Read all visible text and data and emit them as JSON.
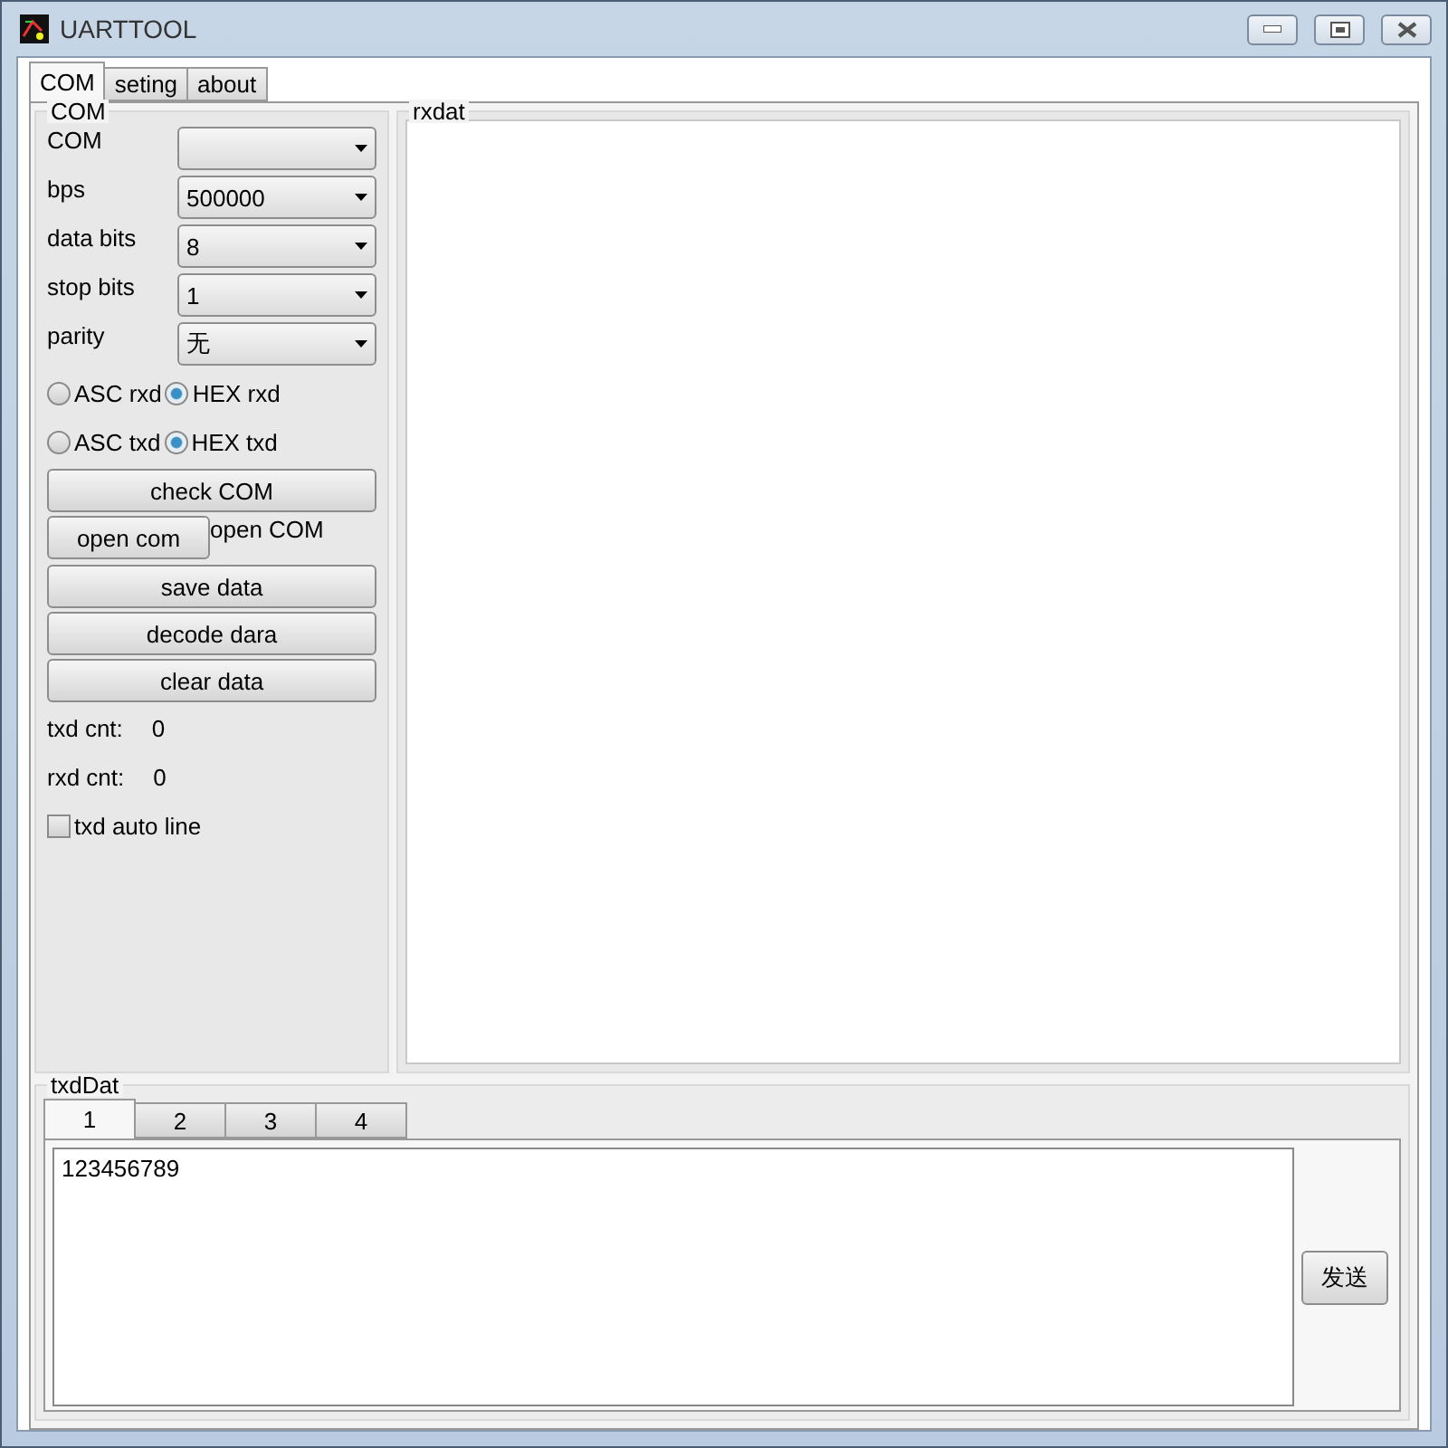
{
  "window": {
    "title": "UARTTOOL"
  },
  "tabs": [
    {
      "label": "COM",
      "selected": true
    },
    {
      "label": "seting",
      "selected": false
    },
    {
      "label": "about",
      "selected": false
    }
  ],
  "com_group": {
    "title": "COM",
    "fields": [
      {
        "label": "COM"
      },
      {
        "label": "bps",
        "value": "500000"
      },
      {
        "label": "data bits",
        "value": "8"
      },
      {
        "label": "stop bits",
        "value": "1"
      },
      {
        "label": "parity",
        "value": "无"
      }
    ],
    "radio_rows": [
      [
        {
          "label": "ASC rxd",
          "selected": false
        },
        {
          "label": "HEX rxd",
          "selected": true
        }
      ],
      [
        {
          "label": "ASC txd",
          "selected": false
        },
        {
          "label": "HEX txd",
          "selected": true
        }
      ]
    ],
    "check_button": "check COM",
    "open_button": "open com",
    "open_status": "open COM",
    "buttons": [
      "save data",
      "decode dara",
      "clear data"
    ],
    "counters": [
      {
        "label": "txd cnt:",
        "value": "0"
      },
      {
        "label": "rxd cnt:",
        "value": "0"
      }
    ],
    "auto_line": {
      "label": "txd auto line",
      "checked": false
    }
  },
  "rxdat": {
    "title": "rxdat"
  },
  "txd": {
    "title": "txdDat",
    "tabs": [
      {
        "label": "1",
        "selected": true
      },
      {
        "label": "2",
        "selected": false
      },
      {
        "label": "3",
        "selected": false
      },
      {
        "label": "4",
        "selected": false
      }
    ],
    "text": "123456789",
    "send": "发送"
  }
}
